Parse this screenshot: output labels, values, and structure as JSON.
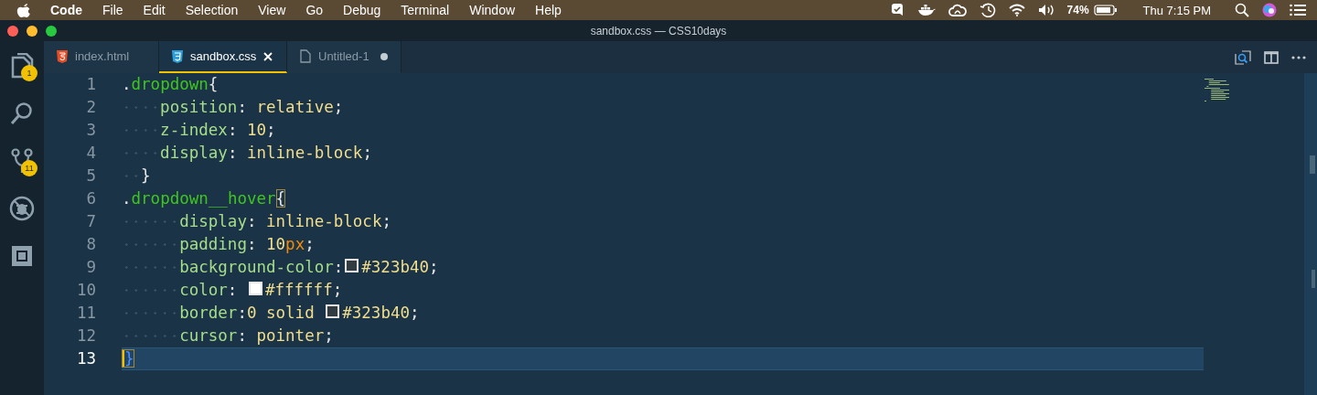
{
  "menu_bar": {
    "app": "Code",
    "items": [
      "File",
      "Edit",
      "Selection",
      "View",
      "Go",
      "Debug",
      "Terminal",
      "Window",
      "Help"
    ],
    "battery_percent": "74%",
    "clock": "Thu 7:15 PM"
  },
  "window": {
    "title": "sandbox.css — CSS10days"
  },
  "activity_bar": [
    {
      "kind": "files",
      "badge": "1"
    },
    {
      "kind": "search"
    },
    {
      "kind": "git",
      "badge": "11"
    },
    {
      "kind": "debug"
    },
    {
      "kind": "extensions"
    }
  ],
  "tabs": [
    {
      "label": "index.html",
      "kind": "html",
      "selected": false,
      "dirty": false
    },
    {
      "label": "sandbox.css",
      "kind": "css",
      "selected": true,
      "dirty": false
    },
    {
      "label": "Untitled-1",
      "kind": "file",
      "selected": false,
      "dirty": true
    }
  ],
  "editor": {
    "lines": [
      {
        "number": "1",
        "kind": "selector",
        "current": false,
        "tokens": [
          {
            "kind": "punct",
            "text": "."
          },
          {
            "kind": "sel",
            "text": "dropdown"
          },
          {
            "kind": "punct",
            "text": "{"
          }
        ]
      },
      {
        "number": "2",
        "kind": "declaration",
        "current": false,
        "tokens": [
          {
            "kind": "prop",
            "text": "position"
          },
          {
            "kind": "punct",
            "text": ": "
          },
          {
            "kind": "val",
            "text": "relative"
          },
          {
            "kind": "punct",
            "text": ";"
          }
        ]
      },
      {
        "number": "3",
        "kind": "declaration",
        "current": false,
        "tokens": [
          {
            "kind": "prop",
            "text": "z-index"
          },
          {
            "kind": "punct",
            "text": ": "
          },
          {
            "kind": "val",
            "text": "10"
          },
          {
            "kind": "punct",
            "text": ";"
          }
        ]
      },
      {
        "number": "4",
        "kind": "declaration",
        "current": false,
        "tokens": [
          {
            "kind": "prop",
            "text": "display"
          },
          {
            "kind": "punct",
            "text": ": "
          },
          {
            "kind": "val",
            "text": "inline-block"
          },
          {
            "kind": "punct",
            "text": ";"
          }
        ]
      },
      {
        "number": "5",
        "kind": "close",
        "current": false,
        "tokens": [
          {
            "kind": "punct",
            "text": "}"
          }
        ]
      },
      {
        "number": "6",
        "kind": "selector",
        "current": false,
        "tokens": [
          {
            "kind": "punct",
            "text": "."
          },
          {
            "kind": "sel",
            "text": "dropdown__hover"
          },
          {
            "kind": "bracket",
            "text": "{"
          }
        ]
      },
      {
        "number": "7",
        "kind": "inner_declaration",
        "current": false,
        "tokens": [
          {
            "kind": "prop",
            "text": "display"
          },
          {
            "kind": "punct",
            "text": ": "
          },
          {
            "kind": "val",
            "text": "inline-block"
          },
          {
            "kind": "punct",
            "text": ";"
          }
        ]
      },
      {
        "number": "8",
        "kind": "inner_declaration",
        "current": false,
        "tokens": [
          {
            "kind": "prop",
            "text": "padding"
          },
          {
            "kind": "punct",
            "text": ": "
          },
          {
            "kind": "val",
            "text": "10"
          },
          {
            "kind": "unit",
            "text": "px"
          },
          {
            "kind": "punct",
            "text": ";"
          }
        ]
      },
      {
        "number": "9",
        "kind": "inner_declaration",
        "current": false,
        "tokens": [
          {
            "kind": "prop",
            "text": "background-color"
          },
          {
            "kind": "punct",
            "text": ":"
          },
          {
            "kind": "swatch",
            "color": "#323b40"
          },
          {
            "kind": "val",
            "text": "#323b40"
          },
          {
            "kind": "punct",
            "text": ";"
          }
        ]
      },
      {
        "number": "10",
        "kind": "inner_declaration",
        "current": false,
        "tokens": [
          {
            "kind": "prop",
            "text": "color"
          },
          {
            "kind": "punct",
            "text": ": "
          },
          {
            "kind": "swatch",
            "color": "#ffffff"
          },
          {
            "kind": "val",
            "text": "#ffffff"
          },
          {
            "kind": "punct",
            "text": ";"
          }
        ]
      },
      {
        "number": "11",
        "kind": "inner_declaration",
        "current": false,
        "tokens": [
          {
            "kind": "prop",
            "text": "border"
          },
          {
            "kind": "punct",
            "text": ":"
          },
          {
            "kind": "val",
            "text": "0 solid "
          },
          {
            "kind": "swatch",
            "color": "#323b40"
          },
          {
            "kind": "val",
            "text": "#323b40"
          },
          {
            "kind": "punct",
            "text": ";"
          }
        ]
      },
      {
        "number": "12",
        "kind": "inner_declaration",
        "current": false,
        "tokens": [
          {
            "kind": "prop",
            "text": "cursor"
          },
          {
            "kind": "punct",
            "text": ": "
          },
          {
            "kind": "val",
            "text": "pointer"
          },
          {
            "kind": "punct",
            "text": ";"
          }
        ]
      },
      {
        "number": "13",
        "kind": "selector",
        "current": true,
        "tokens": [
          {
            "kind": "bracket",
            "text": "}"
          }
        ]
      }
    ]
  }
}
